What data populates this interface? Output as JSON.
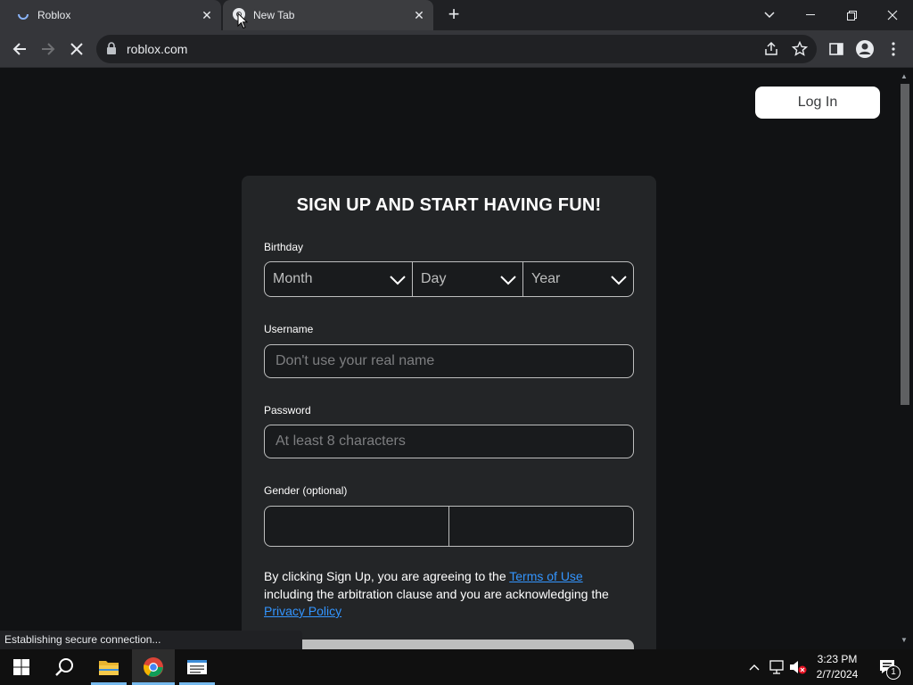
{
  "browser": {
    "tabs": [
      {
        "title": "Roblox",
        "icon": "loading-spinner-icon",
        "active": false
      },
      {
        "title": "New Tab",
        "icon": "chrome-icon",
        "active": true
      }
    ],
    "address_bar": {
      "url": "roblox.com"
    },
    "status_text": "Establishing secure connection..."
  },
  "page": {
    "login_label": "Log In",
    "signup_title": "SIGN UP AND START HAVING FUN!",
    "birthday_label": "Birthday",
    "month_value": "Month",
    "day_value": "Day",
    "year_value": "Year",
    "username_label": "Username",
    "username_placeholder": "Don't use your real name",
    "password_label": "Password",
    "password_placeholder": "At least 8 characters",
    "gender_label": "Gender (optional)",
    "legal_prefix": "By clicking Sign Up, you are agreeing to the",
    "terms_link": "Terms of Use",
    "legal_middle": "including the arbitration clause and you are acknowledging the",
    "privacy_link": "Privacy Policy"
  },
  "taskbar": {
    "time": "3:23 PM",
    "date": "2/7/2024",
    "notification_count": "1",
    "apps": [
      "start-icon",
      "search-icon",
      "file-explorer-icon",
      "chrome-icon",
      "notepad-icon"
    ]
  },
  "colors": {
    "page_bg": "#111214",
    "card_bg": "#232527",
    "link": "#3395ff",
    "tabbar": "#202124"
  }
}
